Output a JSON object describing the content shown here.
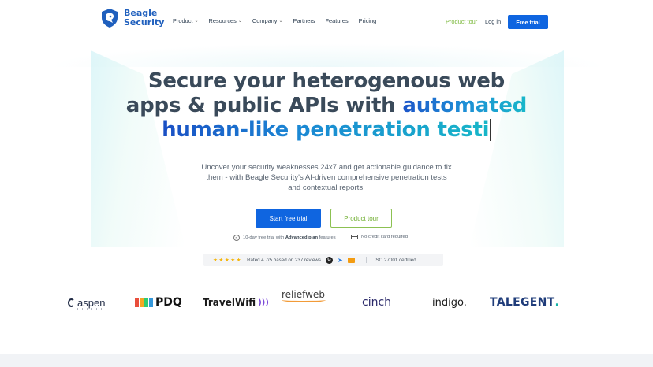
{
  "brand": {
    "line1": "Beagle",
    "line2": "Security",
    "color": "#1f5fbd"
  },
  "nav": {
    "items": [
      {
        "label": "Product",
        "dropdown": true
      },
      {
        "label": "Resources",
        "dropdown": true
      },
      {
        "label": "Company",
        "dropdown": true
      },
      {
        "label": "Partners",
        "dropdown": false
      },
      {
        "label": "Features",
        "dropdown": false
      },
      {
        "label": "Pricing",
        "dropdown": false
      }
    ],
    "product_tour": "Product tour",
    "login": "Log in",
    "free_trial": "Free trial"
  },
  "hero": {
    "headline_line1": "Secure your heterogenous web",
    "headline_line2_plain": "apps & public APIs with ",
    "headline_line2_accent": "automated",
    "headline_line3_accent": "human-like penetration testi",
    "subcopy": "Uncover your security weaknesses 24x7 and get actionable guidance to fix them - with Beagle Security's AI-driven comprehensive penetration tests and contextual reports.",
    "cta_primary": "Start free trial",
    "cta_secondary": "Product tour",
    "assurance_1_prefix": "10-day free trial with ",
    "assurance_1_bold": "Advanced plan",
    "assurance_1_suffix": " features",
    "assurance_2": "No credit card required",
    "rating_stars": "★★★★★",
    "rating_text": "Rated 4.7/5 based on 237 reviews",
    "iso_text": "ISO 27001 certified"
  },
  "client_logos": {
    "aspen": "aspen",
    "pdq": "PDQ",
    "travelwifi": "TravelWifi",
    "reliefweb": "reliefweb",
    "cinch": "cinch",
    "indigo": "indigo.",
    "talegent": "TALEGENT"
  },
  "colors": {
    "primary": "#0f65e0",
    "accent_green": "#7ab83a",
    "headline": "#3a4a5a"
  }
}
